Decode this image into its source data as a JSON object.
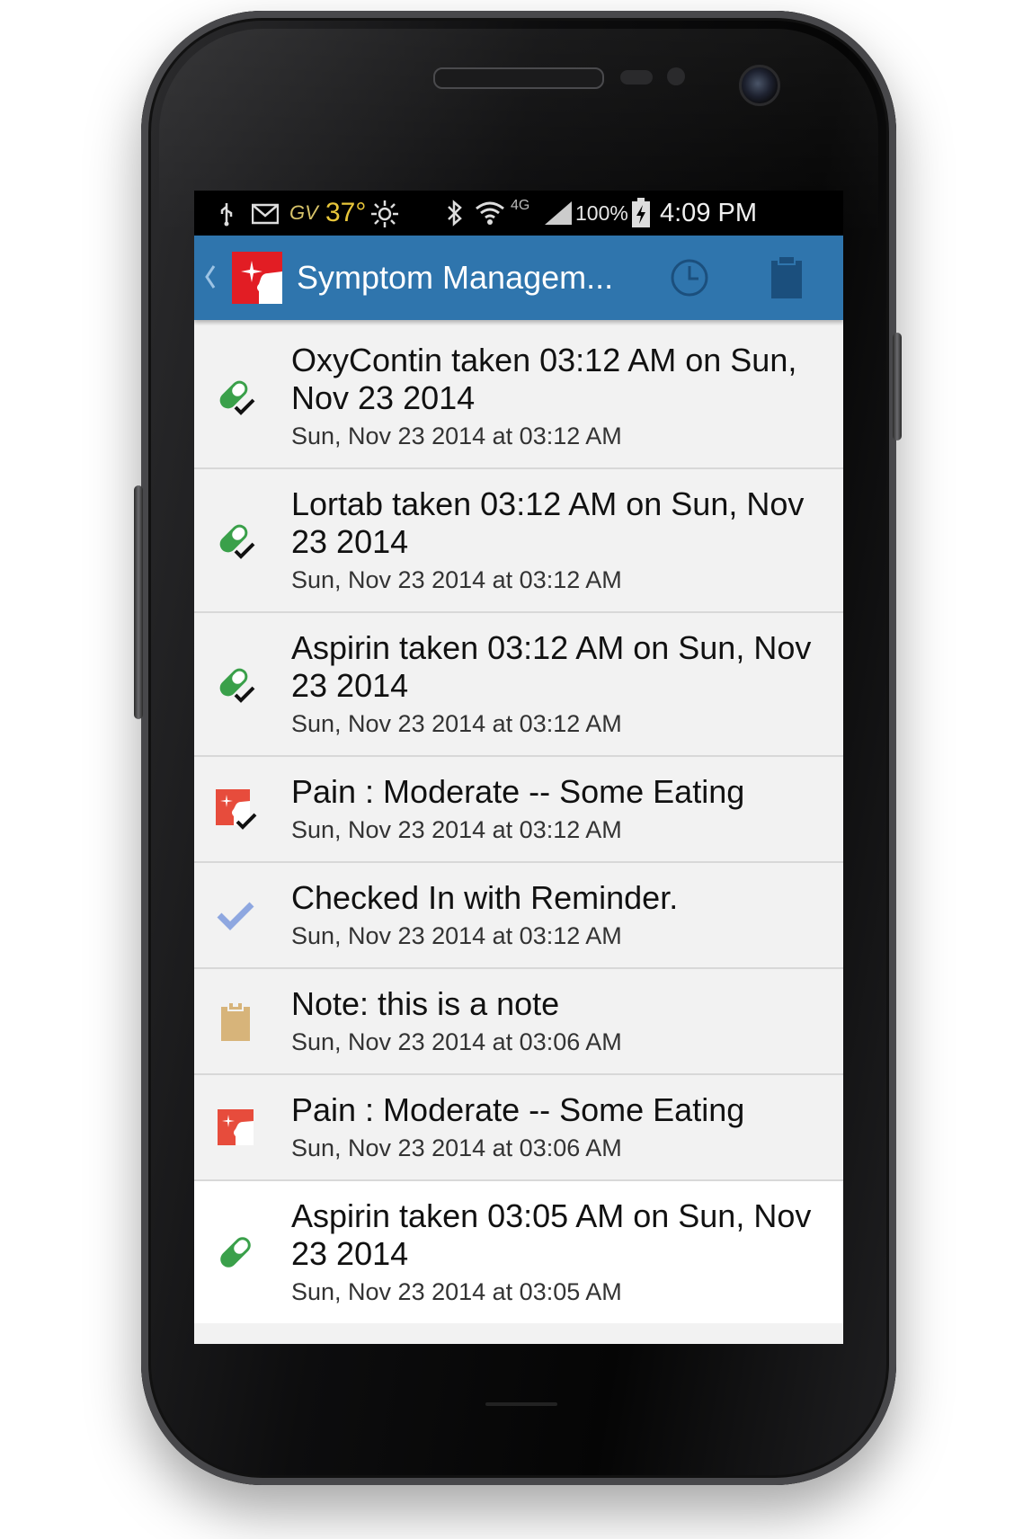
{
  "status_bar": {
    "weather": "37°",
    "gv": "GV",
    "network": "4G",
    "battery": "100%",
    "time": "4:09 PM"
  },
  "app_bar": {
    "title": "Symptom Managem..."
  },
  "colors": {
    "app_bar": "#2f75ad",
    "pill_green": "#3aa04a",
    "logo_red": "#e53935",
    "check_blue": "#8ea7e0",
    "note_tan": "#d7b47a"
  },
  "entries": [
    {
      "icon": "pill-check-icon",
      "title": "OxyContin taken  03:12 AM on Sun, Nov 23 2014",
      "subtitle": "Sun, Nov 23 2014 at 03:12 AM"
    },
    {
      "icon": "pill-check-icon",
      "title": "Lortab taken  03:12 AM on Sun, Nov 23 2014",
      "subtitle": "Sun, Nov 23 2014 at 03:12 AM"
    },
    {
      "icon": "pill-check-icon",
      "title": "Aspirin taken  03:12 AM on Sun, Nov 23 2014",
      "subtitle": "Sun, Nov 23 2014 at 03:12 AM"
    },
    {
      "icon": "pain-check-icon",
      "title": "Pain : Moderate -- Some Eating",
      "subtitle": "Sun, Nov 23 2014 at 03:12 AM"
    },
    {
      "icon": "checkmark-icon",
      "title": "Checked In with Reminder.",
      "subtitle": "Sun, Nov 23 2014 at 03:12 AM"
    },
    {
      "icon": "clipboard-note-icon",
      "title": "Note: this is a note",
      "subtitle": "Sun, Nov 23 2014 at 03:06 AM"
    },
    {
      "icon": "pain-icon",
      "title": "Pain : Moderate -- Some Eating",
      "subtitle": "Sun, Nov 23 2014 at 03:06 AM"
    },
    {
      "icon": "pill-icon",
      "title": "Aspirin taken  03:05 AM on Sun, Nov 23 2014",
      "subtitle": "Sun, Nov 23 2014 at 03:05 AM"
    }
  ]
}
